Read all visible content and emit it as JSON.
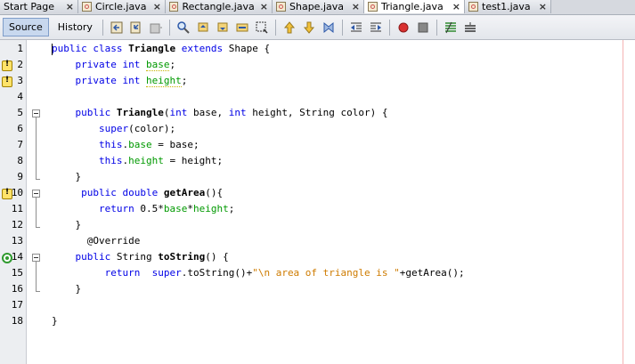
{
  "tabs": [
    {
      "label": "Start Page",
      "active": false
    },
    {
      "label": "Circle.java",
      "active": false
    },
    {
      "label": "Rectangle.java",
      "active": false
    },
    {
      "label": "Shape.java",
      "active": false
    },
    {
      "label": "Triangle.java",
      "active": true
    },
    {
      "label": "test1.java",
      "active": false
    }
  ],
  "toolbar": {
    "source_label": "Source",
    "history_label": "History",
    "icons": [
      "last-edit-icon",
      "back-icon",
      "forward-icon",
      "find-icon",
      "find-previous-icon",
      "find-next-icon",
      "toggle-highlight-icon",
      "find-selection-icon",
      "previous-bookmark-icon",
      "next-bookmark-icon",
      "toggle-bookmark-icon",
      "shift-left-icon",
      "shift-right-icon",
      "start-macro-icon",
      "stop-macro-icon",
      "comment-icon",
      "uncomment-icon"
    ]
  },
  "line_numbers": [
    "1",
    "2",
    "3",
    "4",
    "5",
    "6",
    "7",
    "8",
    "9",
    "10",
    "11",
    "12",
    "13",
    "14",
    "15",
    "16",
    "17",
    "18"
  ],
  "code": {
    "l1_a": "public",
    "l1_b": " class ",
    "l1_c": "Triangle",
    "l1_d": " extends ",
    "l1_e": "Shape {",
    "l2_a": "    private int ",
    "l2_b": "base",
    "l2_c": ";",
    "l3_a": "    private int ",
    "l3_b": "height",
    "l3_c": ";",
    "l5_a": "    public ",
    "l5_b": "Triangle",
    "l5_c": "(",
    "l5_d": "int",
    "l5_e": " base, ",
    "l5_f": "int",
    "l5_g": " height, String color) {",
    "l6_a": "        super",
    "l6_b": "(color);",
    "l7_a": "        this",
    "l7_b": ".",
    "l7_c": "base",
    "l7_d": " = base;",
    "l8_a": "        this",
    "l8_b": ".",
    "l8_c": "height",
    "l8_d": " = height;",
    "l9": "    }",
    "l10_a": "     public double ",
    "l10_b": "getArea",
    "l10_c": "(){",
    "l11_a": "        return ",
    "l11_b": "0.5*",
    "l11_c": "base",
    "l11_d": "*",
    "l11_e": "height",
    "l11_f": ";",
    "l12": "    }",
    "l13": "      @Override",
    "l14_a": "    public ",
    "l14_b": "String ",
    "l14_c": "toString",
    "l14_d": "() {",
    "l15_a": "         return  ",
    "l15_b": "super",
    "l15_c": ".toString()+",
    "l15_d": "\"\\n area of triangle is \"",
    "l15_e": "+getArea();",
    "l16": "    }",
    "l18": "}"
  }
}
